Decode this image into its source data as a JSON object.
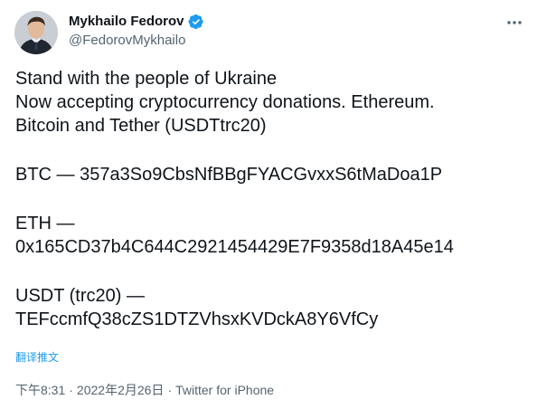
{
  "author": {
    "display_name": "Mykhailo Fedorov",
    "handle": "@FedorovMykhailo",
    "verified_icon": "verified-badge-icon",
    "avatar_icon": "profile-photo"
  },
  "more_icon": "ellipsis-icon",
  "tweet": {
    "lines": [
      "Stand with the people of Ukraine",
      "Now accepting cryptocurrency donations. Ethereum.",
      "Bitcoin and Tether (USDTtrc20)",
      "BTC — 357a3So9CbsNfBBgFYACGvxxS6tMaDoa1P",
      "ETH —",
      "0x165CD37b4C644C2921454429E7F9358d18A45e14",
      "USDT (trc20) —",
      "TEFccmfQ38cZS1DTZVhsxKVDckA8Y6VfCy"
    ]
  },
  "translate_label": "翻译推文",
  "meta": {
    "time": "下午8:31",
    "separator": "·",
    "date": "2022年2月26日",
    "source": "Twitter for iPhone"
  },
  "colors": {
    "link": "#1d9bf0",
    "secondary": "#536471",
    "text": "#0f1419"
  }
}
